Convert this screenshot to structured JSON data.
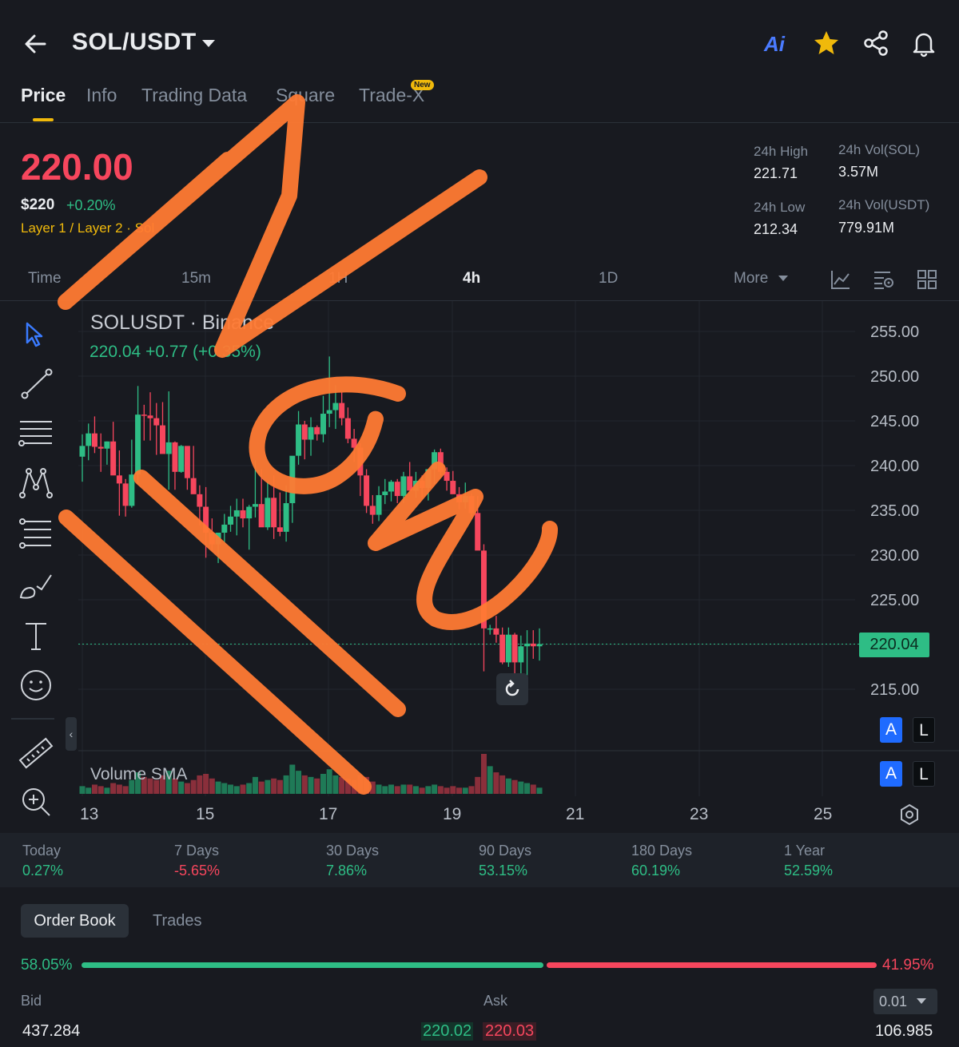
{
  "header": {
    "pair": "SOL/USDT",
    "ai_label": "Ai",
    "icons": [
      "back-arrow-icon",
      "chevron-down-icon",
      "ai-icon",
      "star-icon",
      "share-icon",
      "bell-icon"
    ]
  },
  "tabs": [
    {
      "label": "Price",
      "active": true
    },
    {
      "label": "Info"
    },
    {
      "label": "Trading Data"
    },
    {
      "label": "Square"
    },
    {
      "label": "Trade-X",
      "badge": "New"
    }
  ],
  "price": {
    "last": "220.00",
    "fiat": "$220",
    "change": "+0.20%",
    "tags": "Layer 1 / Layer 2 · Sol"
  },
  "stats": {
    "high_label": "24h High",
    "high_value": "221.71",
    "low_label": "24h Low",
    "low_value": "212.34",
    "vol_sol_label": "24h Vol(SOL)",
    "vol_sol_value": "3.57M",
    "vol_usdt_label": "24h Vol(USDT)",
    "vol_usdt_value": "779.91M"
  },
  "intervals": [
    {
      "label": "Time"
    },
    {
      "label": "15m"
    },
    {
      "label": "1H"
    },
    {
      "label": "4h",
      "active": true
    },
    {
      "label": "1D"
    },
    {
      "label": "More"
    }
  ],
  "chart": {
    "symbol": "SOLUSDT · Binance",
    "quote": "220.04  +0.77 (+0.35%)",
    "volume_label": "Volume SMA",
    "current_price_tag": "220.04",
    "al": {
      "a": "A",
      "l": "L"
    }
  },
  "chart_data": {
    "type": "candlestick",
    "y_ticks": [
      "255.00",
      "250.00",
      "245.00",
      "240.00",
      "235.00",
      "230.00",
      "225.00",
      "220.00",
      "215.00"
    ],
    "ylim": [
      212,
      257
    ],
    "x_ticks": [
      "13",
      "15",
      "17",
      "19",
      "21",
      "23",
      "25"
    ],
    "last_price": 220.04,
    "candles": [
      [
        241.0,
        243.5,
        238.2,
        242.2
      ],
      [
        242.2,
        244.7,
        240.6,
        243.6
      ],
      [
        243.6,
        245.5,
        241.4,
        242.1
      ],
      [
        242.1,
        243.6,
        239.3,
        241.9
      ],
      [
        241.9,
        242.7,
        240.1,
        242.7
      ],
      [
        242.7,
        244.9,
        240.8,
        238.9
      ],
      [
        238.9,
        241.7,
        234.4,
        238.0
      ],
      [
        238.0,
        238.5,
        234.3,
        235.5
      ],
      [
        235.5,
        242.9,
        235.3,
        239.0
      ],
      [
        239.0,
        248.9,
        237.9,
        245.7
      ],
      [
        245.7,
        246.8,
        242.8,
        245.6
      ],
      [
        245.6,
        248.2,
        242.8,
        245.3
      ],
      [
        245.3,
        247.0,
        241.2,
        244.5
      ],
      [
        244.5,
        247.1,
        242.1,
        241.3
      ],
      [
        241.3,
        248.3,
        237.3,
        242.6
      ],
      [
        242.6,
        242.7,
        237.3,
        239.3
      ],
      [
        239.3,
        242.3,
        239.2,
        242.2
      ],
      [
        242.2,
        241.2,
        237.3,
        238.6
      ],
      [
        238.6,
        242.2,
        236.9,
        236.8
      ],
      [
        236.8,
        237.8,
        233.3,
        235.4
      ],
      [
        235.4,
        237.6,
        229.7,
        232.5
      ],
      [
        232.5,
        234.1,
        230.5,
        231.2
      ],
      [
        231.2,
        231.6,
        229.1,
        232.5
      ],
      [
        232.5,
        234.6,
        231.4,
        233.4
      ],
      [
        233.4,
        235.5,
        232.6,
        234.3
      ],
      [
        234.3,
        236.3,
        232.2,
        235.0
      ],
      [
        235.0,
        236.3,
        233.1,
        234.1
      ],
      [
        234.1,
        235.6,
        230.6,
        235.4
      ],
      [
        235.4,
        240.6,
        234.2,
        235.7
      ],
      [
        235.7,
        239.6,
        234.2,
        233.1
      ],
      [
        233.1,
        238.2,
        232.8,
        236.4
      ],
      [
        236.4,
        238.9,
        231.8,
        233.1
      ],
      [
        233.1,
        237.0,
        232.1,
        232.6
      ],
      [
        232.6,
        237.8,
        231.5,
        235.8
      ],
      [
        235.8,
        241.0,
        233.6,
        241.1
      ],
      [
        241.1,
        246.1,
        240.1,
        244.6
      ],
      [
        244.6,
        245.0,
        240.7,
        242.9
      ],
      [
        242.9,
        245.4,
        241.1,
        244.3
      ],
      [
        244.3,
        244.5,
        242.8,
        243.5
      ],
      [
        243.5,
        247.8,
        242.6,
        245.8
      ],
      [
        245.8,
        252.2,
        244.3,
        246.2
      ],
      [
        246.2,
        249.0,
        244.1,
        247.0
      ],
      [
        247.0,
        248.2,
        244.5,
        245.3
      ],
      [
        245.3,
        246.5,
        242.5,
        243.0
      ],
      [
        243.0,
        244.1,
        240.4,
        242.0
      ],
      [
        242.0,
        242.5,
        236.6,
        238.9
      ],
      [
        238.9,
        239.6,
        234.7,
        235.5
      ],
      [
        235.5,
        236.7,
        233.5,
        234.5
      ],
      [
        234.5,
        237.7,
        233.8,
        236.7
      ],
      [
        236.7,
        238.5,
        235.7,
        237.1
      ],
      [
        237.1,
        238.4,
        236.0,
        238.2
      ],
      [
        238.2,
        238.5,
        235.8,
        236.6
      ],
      [
        236.6,
        239.3,
        235.8,
        238.8
      ],
      [
        238.8,
        240.4,
        237.8,
        237.2
      ],
      [
        237.2,
        239.3,
        236.4,
        238.3
      ],
      [
        238.3,
        238.9,
        236.5,
        237.5
      ],
      [
        237.5,
        238.6,
        236.1,
        239.6
      ],
      [
        239.6,
        241.8,
        237.9,
        241.5
      ],
      [
        241.5,
        241.9,
        238.9,
        239.3
      ],
      [
        239.3,
        239.8,
        237.2,
        238.3
      ],
      [
        238.3,
        239.4,
        237.0,
        236.8
      ],
      [
        236.8,
        237.6,
        235.1,
        235.9
      ],
      [
        235.9,
        238.1,
        235.2,
        236.6
      ],
      [
        236.6,
        236.9,
        234.3,
        234.7
      ],
      [
        234.7,
        236.6,
        232.1,
        230.5
      ],
      [
        230.5,
        231.2,
        217.0,
        221.8
      ],
      [
        221.8,
        222.2,
        221.1,
        221.8
      ],
      [
        221.8,
        223.2,
        220.2,
        221.1
      ],
      [
        221.1,
        221.9,
        217.8,
        218.0
      ],
      [
        218.0,
        221.9,
        217.5,
        221.1
      ],
      [
        221.1,
        221.3,
        214.3,
        218.0
      ],
      [
        218.0,
        221.0,
        216.7,
        219.8
      ],
      [
        219.8,
        221.6,
        216.5,
        220.1
      ],
      [
        220.1,
        221.6,
        218.4,
        219.8
      ],
      [
        219.8,
        221.8,
        218.2,
        220.04
      ]
    ],
    "volumes": [
      5,
      4,
      6,
      5,
      4,
      7,
      6,
      5,
      9,
      14,
      11,
      10,
      9,
      12,
      15,
      10,
      8,
      7,
      9,
      12,
      13,
      10,
      8,
      7,
      6,
      5,
      6,
      7,
      11,
      8,
      9,
      10,
      9,
      12,
      19,
      15,
      12,
      11,
      10,
      13,
      16,
      12,
      11,
      10,
      9,
      12,
      11,
      8,
      6,
      5,
      6,
      5,
      6,
      6,
      5,
      4,
      5,
      6,
      5,
      4,
      5,
      4,
      4,
      5,
      11,
      26,
      18,
      14,
      12,
      10,
      9,
      8,
      7,
      6,
      4
    ]
  },
  "toolbar_icons": [
    "cursor-icon",
    "trendline-icon",
    "horizontal-lines-icon",
    "pattern-icon",
    "fib-icon",
    "brush-icon",
    "text-icon",
    "emoji-icon",
    "ruler-icon",
    "zoom-in-icon"
  ],
  "performance": [
    {
      "label": "Today",
      "value": "0.27%",
      "dir": "up"
    },
    {
      "label": "7 Days",
      "value": "-5.65%",
      "dir": "down"
    },
    {
      "label": "30 Days",
      "value": "7.86%",
      "dir": "up"
    },
    {
      "label": "90 Days",
      "value": "53.15%",
      "dir": "up"
    },
    {
      "label": "180 Days",
      "value": "60.19%",
      "dir": "up"
    },
    {
      "label": "1 Year",
      "value": "52.59%",
      "dir": "up"
    }
  ],
  "orderbook": {
    "tab_active": "Order Book",
    "tab_other": "Trades",
    "bid_pct": "58.05%",
    "ask_pct": "41.95%",
    "bid_fraction": 0.5805,
    "bid_header": "Bid",
    "ask_header": "Ask",
    "precision": "0.01",
    "bid_qty": "437.284",
    "bid_price": "220.02",
    "ask_price": "220.03",
    "ask_qty": "106.985"
  },
  "colors": {
    "background": "#181a20",
    "up": "#2ebd85",
    "down": "#f6465d",
    "accent": "#f0b90b",
    "annotation": "#ff7a33"
  }
}
